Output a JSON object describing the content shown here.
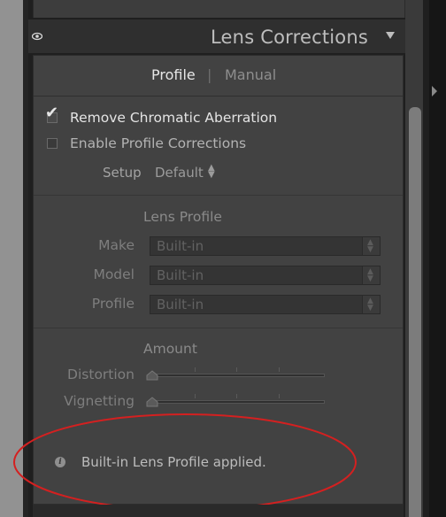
{
  "header": {
    "title": "Lens Corrections"
  },
  "tabs": {
    "profile": "Profile",
    "separator": "|",
    "manual": "Manual"
  },
  "checkboxes": [
    {
      "label": "Remove Chromatic Aberration",
      "checked": true
    },
    {
      "label": "Enable Profile Corrections",
      "checked": false
    }
  ],
  "setup": {
    "label": "Setup",
    "value": "Default",
    "arrows": "⬍"
  },
  "lens_profile": {
    "heading": "Lens Profile",
    "fields": [
      {
        "label": "Make",
        "value": "Built-in"
      },
      {
        "label": "Model",
        "value": "Built-in"
      },
      {
        "label": "Profile",
        "value": "Built-in"
      }
    ]
  },
  "amount": {
    "heading": "Amount",
    "sliders": [
      {
        "label": "Distortion"
      },
      {
        "label": "Vignetting"
      }
    ]
  },
  "info": {
    "icon": "i",
    "text": "Built-in Lens Profile applied."
  },
  "colors": {
    "annotation": "#d42020",
    "panel_bg": "#424242",
    "header_bg": "#2f2f2f"
  }
}
